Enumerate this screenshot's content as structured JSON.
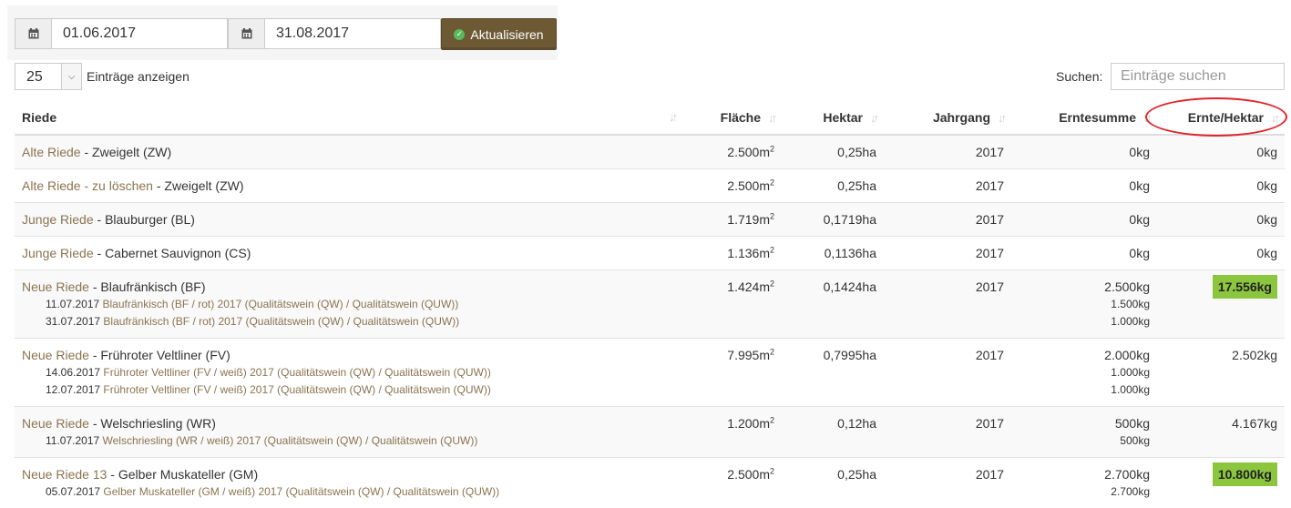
{
  "filters": {
    "date_from": "01.06.2017",
    "date_to": "31.08.2017",
    "update_label": "Aktualisieren"
  },
  "length": {
    "value": "25",
    "label": "Einträge anzeigen"
  },
  "search": {
    "label": "Suchen:",
    "placeholder": "Einträge suchen"
  },
  "columns": [
    "Riede",
    "Fläche",
    "Hektar",
    "Jahrgang",
    "Erntesumme",
    "Ernte/Hektar"
  ],
  "rows": [
    {
      "riede": "Alte Riede",
      "sorte": " - Zweigelt (ZW)",
      "flaeche": "2.500m",
      "hektar": "0,25ha",
      "jahrgang": "2017",
      "erntesumme": "0kg",
      "ernte_hektar": "0kg",
      "subs": []
    },
    {
      "riede": "Alte Riede - zu löschen",
      "sorte": " - Zweigelt (ZW)",
      "flaeche": "2.500m",
      "hektar": "0,25ha",
      "jahrgang": "2017",
      "erntesumme": "0kg",
      "ernte_hektar": "0kg",
      "subs": []
    },
    {
      "riede": "Junge Riede",
      "sorte": " - Blauburger (BL)",
      "flaeche": "1.719m",
      "hektar": "0,1719ha",
      "jahrgang": "2017",
      "erntesumme": "0kg",
      "ernte_hektar": "0kg",
      "subs": []
    },
    {
      "riede": "Junge Riede",
      "sorte": " - Cabernet Sauvignon (CS)",
      "flaeche": "1.136m",
      "hektar": "0,1136ha",
      "jahrgang": "2017",
      "erntesumme": "0kg",
      "ernte_hektar": "0kg",
      "subs": []
    },
    {
      "riede": "Neue Riede",
      "sorte": " - Blaufränkisch (BF)",
      "flaeche": "1.424m",
      "hektar": "0,1424ha",
      "jahrgang": "2017",
      "erntesumme": "2.500kg",
      "ernte_hektar": "17.556kg",
      "highlight": true,
      "subs": [
        {
          "date": "11.07.2017",
          "text": "Blaufränkisch (BF / rot) 2017 (Qualitätswein (QW) / Qualitätswein (QUW))",
          "kg": "1.500kg"
        },
        {
          "date": "31.07.2017",
          "text": "Blaufränkisch (BF / rot) 2017 (Qualitätswein (QW) / Qualitätswein (QUW))",
          "kg": "1.000kg"
        }
      ]
    },
    {
      "riede": "Neue Riede",
      "sorte": " - Frühroter Veltliner (FV)",
      "flaeche": "7.995m",
      "hektar": "0,7995ha",
      "jahrgang": "2017",
      "erntesumme": "2.000kg",
      "ernte_hektar": "2.502kg",
      "subs": [
        {
          "date": "14.06.2017",
          "text": "Frühroter Veltliner (FV / weiß) 2017 (Qualitätswein (QW) / Qualitätswein (QUW))",
          "kg": "1.000kg"
        },
        {
          "date": "12.07.2017",
          "text": "Frühroter Veltliner (FV / weiß) 2017 (Qualitätswein (QW) / Qualitätswein (QUW))",
          "kg": "1.000kg"
        }
      ]
    },
    {
      "riede": "Neue Riede",
      "sorte": " - Welschriesling (WR)",
      "flaeche": "1.200m",
      "hektar": "0,12ha",
      "jahrgang": "2017",
      "erntesumme": "500kg",
      "ernte_hektar": "4.167kg",
      "subs": [
        {
          "date": "11.07.2017",
          "text": "Welschriesling (WR / weiß) 2017 (Qualitätswein (QW) / Qualitätswein (QUW))",
          "kg": "500kg"
        }
      ]
    },
    {
      "riede": "Neue Riede 13",
      "sorte": " - Gelber Muskateller (GM)",
      "flaeche": "2.500m",
      "hektar": "0,25ha",
      "jahrgang": "2017",
      "erntesumme": "2.700kg",
      "ernte_hektar": "10.800kg",
      "highlight": true,
      "subs": [
        {
          "date": "05.07.2017",
          "text": "Gelber Muskateller (GM / weiß) 2017 (Qualitätswein (QW) / Qualitätswein (QUW))",
          "kg": "2.700kg"
        }
      ]
    }
  ],
  "icons": {
    "calendar": "calendar-icon",
    "check": "check-circle-icon",
    "sort": "sort-icon",
    "dropdown": "chevron-down-icon"
  },
  "colors": {
    "button": "#6d5a35",
    "link": "#8a7450",
    "highlight": "#8cc63f",
    "annotation": "#e0242a"
  }
}
